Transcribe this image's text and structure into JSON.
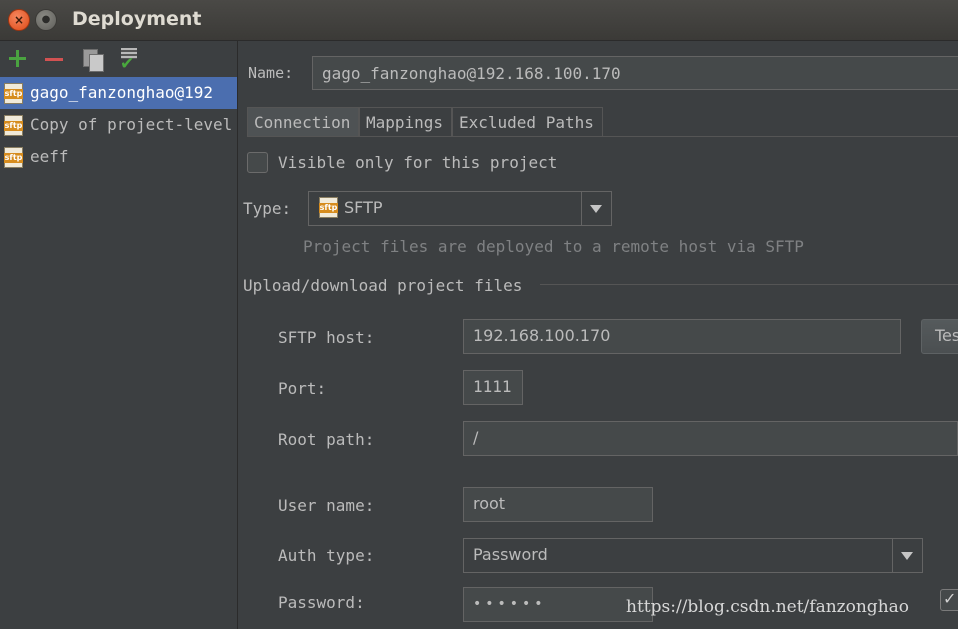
{
  "window": {
    "title": "Deployment",
    "close_glyph": "×",
    "minimize_glyph": "●"
  },
  "toolbar": {
    "add_icon": "plus-icon",
    "remove_icon": "minus-icon",
    "copy_icon": "copy-icon",
    "default_icon": "server-default-icon"
  },
  "servers": [
    {
      "label": "gago_fanzonghao@192",
      "icon_text": "sftp",
      "selected": true
    },
    {
      "label": "Copy of project-level",
      "icon_text": "sftp",
      "selected": false
    },
    {
      "label": "eeff",
      "icon_text": "sftp",
      "selected": false
    }
  ],
  "name": {
    "label": "Name:",
    "value": "gago_fanzonghao@192.168.100.170"
  },
  "tabs": [
    {
      "label": "Connection",
      "active": true
    },
    {
      "label": "Mappings",
      "active": false
    },
    {
      "label": "Excluded Paths",
      "active": false
    }
  ],
  "connection": {
    "visible_only_label": "Visible only for this project",
    "visible_only_checked": false,
    "type_label": "Type:",
    "type_value": "SFTP",
    "type_icon_text": "sftp",
    "type_hint": "Project files are deployed to a remote host via SFTP",
    "section_title": "Upload/download project files",
    "sftp_host_label": "SFTP host:",
    "sftp_host_value": "192.168.100.170",
    "test_button_label": "Test",
    "port_label": "Port:",
    "port_value": "1111",
    "root_path_label": "Root path:",
    "root_path_value": "/",
    "user_name_label": "User name:",
    "user_name_value": "root",
    "auth_type_label": "Auth type:",
    "auth_type_value": "Password",
    "password_label": "Password:",
    "password_mask": "••••••",
    "save_password_glyph": "✓"
  },
  "watermark": "https://blog.csdn.net/fanzonghao",
  "colors": {
    "selection": "#4b6eaf",
    "add": "#4aa340",
    "remove": "#d25252",
    "sftp_badge": "#d68c1e"
  }
}
